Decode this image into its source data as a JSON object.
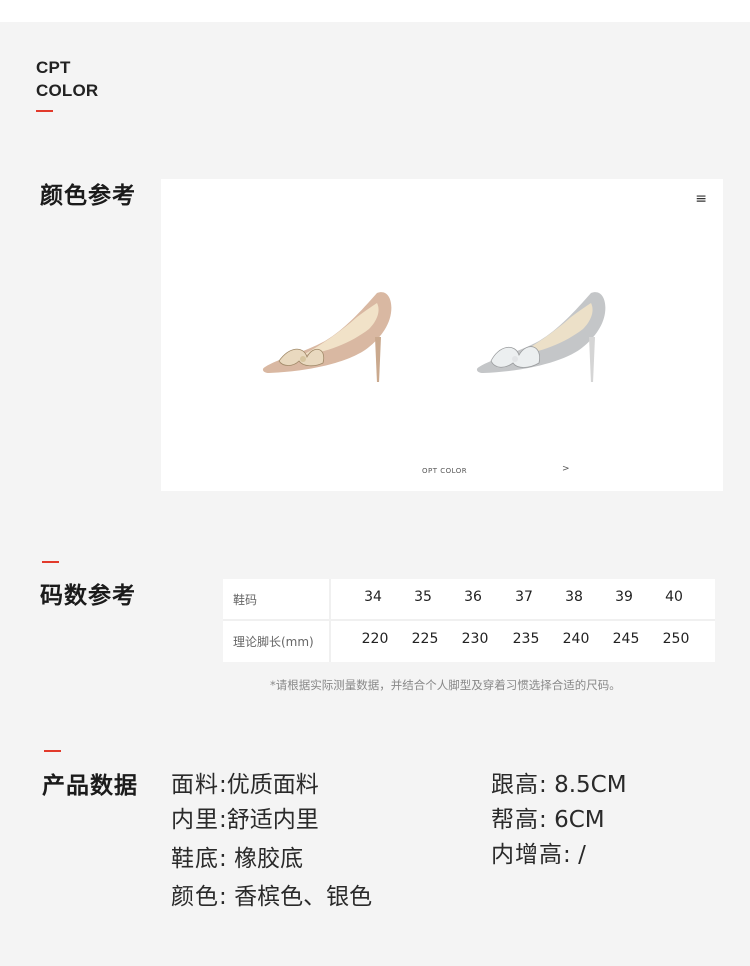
{
  "brand": {
    "line1": "CPT",
    "line2": "COLOR"
  },
  "colors_section": {
    "title": "颜色参考",
    "caption": "OPT COLOR",
    "arrow": ">",
    "menu_icon": "hamburger-menu-icon"
  },
  "size_section": {
    "title": "码数参考",
    "row1_label": "鞋码",
    "row2_label": "理论脚长(mm)",
    "sizes": [
      "34",
      "35",
      "36",
      "37",
      "38",
      "39",
      "40"
    ],
    "lengths": [
      "220",
      "225",
      "230",
      "235",
      "240",
      "245",
      "250"
    ],
    "note": "*请根据实际测量数据，并结合个人脚型及穿着习惯选择合适的尺码。"
  },
  "product_section": {
    "title": "产品数据",
    "left": [
      {
        "key": "面料",
        "value": "优质面料"
      },
      {
        "key": "内里",
        "value": "舒适内里"
      },
      {
        "key": "鞋底",
        "value": "橡胶底"
      },
      {
        "key": "颜色",
        "value": "香槟色、银色"
      }
    ],
    "right": [
      {
        "key": "跟高",
        "value": "8.5CM"
      },
      {
        "key": "帮高",
        "value": "6CM"
      },
      {
        "key": "内增高",
        "value": "/"
      }
    ]
  },
  "colors": {
    "accent": "#e23a2b",
    "champagne": "#d9b8a2",
    "silver": "#c4c6c8"
  }
}
